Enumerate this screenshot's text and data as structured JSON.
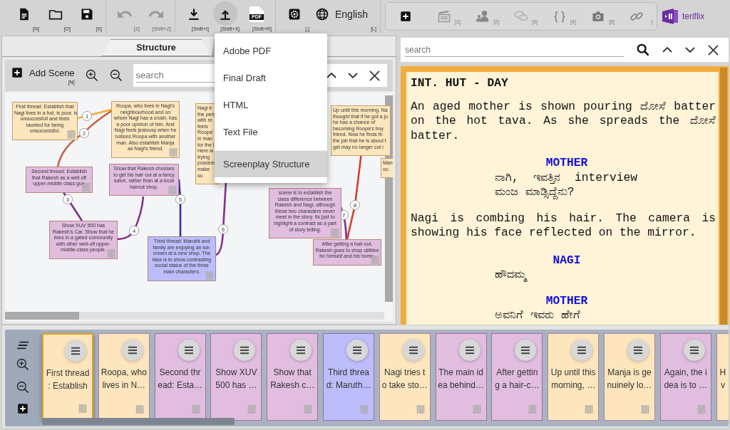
{
  "toolbar": {
    "groups": [
      [
        {
          "kind": "new",
          "shortcut": "[N]",
          "disabled": false,
          "active": false
        },
        {
          "kind": "open",
          "shortcut": "[O]",
          "disabled": false,
          "active": false
        },
        {
          "kind": "save",
          "shortcut": "[S]",
          "disabled": false,
          "active": false
        }
      ],
      [
        {
          "kind": "undo",
          "shortcut": "[Z]",
          "disabled": true,
          "active": false
        },
        {
          "kind": "redo",
          "shortcut": "[Shift+Z]",
          "disabled": true,
          "active": false
        }
      ],
      [
        {
          "kind": "import",
          "shortcut": "[Shift+I]",
          "disabled": false,
          "active": false
        },
        {
          "kind": "export",
          "shortcut": "[Shift+X]",
          "disabled": false,
          "active": true
        },
        {
          "kind": "pdf",
          "icon_text": "PDF",
          "shortcut": "[Shift+R]",
          "disabled": false,
          "active": false
        }
      ],
      [
        {
          "kind": "settings",
          "shortcut": "[,]",
          "disabled": false,
          "active": false
        },
        {
          "kind": "language",
          "label": "English",
          "shortcut": "[L]",
          "disabled": false,
          "active": false
        }
      ]
    ]
  },
  "insert_toolbar": [
    {
      "kind": "add"
    },
    {
      "kind": "scene",
      "shortcut": "[1]"
    },
    {
      "kind": "character",
      "shortcut": "[2]"
    },
    {
      "kind": "dialogue",
      "shortcut": "[3]"
    },
    {
      "kind": "braces",
      "icon_text": "{ }",
      "shortcut": "[4]"
    },
    {
      "kind": "camera",
      "shortcut": "[5]"
    },
    {
      "kind": "link",
      "shortcut": "["
    }
  ],
  "logo": {
    "text": "teriflix"
  },
  "export_menu": [
    {
      "label": "Adobe PDF",
      "selected": false
    },
    {
      "label": "Final Draft",
      "selected": false
    },
    {
      "label": "HTML",
      "selected": false
    },
    {
      "label": "Text File",
      "selected": false
    },
    {
      "label": "Screenplay Structure",
      "selected": true
    }
  ],
  "structure": {
    "tabs": [
      {
        "label": "Structure",
        "selected": true
      },
      {
        "selected": false
      }
    ],
    "add_scene": {
      "label": "Add Scene",
      "shortcut": "[N]"
    },
    "search": {
      "placeholder": "search"
    },
    "notes": [
      {
        "color": "#fde6bd",
        "lines": [
          "First thread: Establish that",
          "Nagi lives in a hut, is poor, is",
          "unsuccesfull and feels",
          "taunted for being",
          "unsuccessful."
        ]
      },
      {
        "color": "#fde6bd",
        "lines": [
          "Roopa, who lives in Nagi's",
          "neighbourhood and on",
          "whom Nagi has a crush, has",
          "a poor opinion of him. And",
          "Nagi feels jealousy when he",
          "notices Roopa with another",
          "man. Also establish Manja",
          "as Nagi's friend."
        ]
      },
      {
        "color": "#fde6bd",
        "lines": [
          "Nagi tr",
          "the pers",
          "with re",
          "feels",
          "Roopa'",
          "in man",
          "for the l",
          "Here w",
          "trying",
          "possess",
          "make",
          "su"
        ]
      },
      {
        "color": "#fde6bd",
        "lines": [
          "Up until this morning, Na",
          "thought that if he got a jo",
          "he has a chance of",
          "becoming Roopa's boy",
          "friend. Now he finds th",
          "the job that he is about t",
          "get may no longer cut i"
        ]
      },
      {
        "color": "#e1bde0",
        "lines": [
          "Second thread: Establish",
          "that Rakesh as a well off",
          "upper-middle class guy."
        ]
      },
      {
        "color": "#e1bde0",
        "lines": [
          "Show that Rakesh chooses",
          "to get his hair cut at a fancy",
          "salon, rather than at a local",
          "haircut shop."
        ]
      },
      {
        "color": "#fde6bd",
        "lines": [
          "Man",
          "ou"
        ]
      },
      {
        "color": "#e1bde0",
        "lines": [
          "scene is to establish the",
          "class difference between",
          "Rakesh and Nagi, although",
          "these two characters never",
          "meet in the story. Its just to",
          "highlight a contrast as a part",
          "of story telling."
        ]
      },
      {
        "color": "#e1bde0",
        "lines": [
          "Show XUV 500 has",
          "Rakesh's Car. Show that he",
          "lives in a gated community",
          "with other well-off upper-",
          "middle-class people."
        ]
      },
      {
        "color": "#bdbdfb",
        "lines": [
          "Third thread: Maruthi and",
          "family are enjoying an ice-",
          "cream at a new shop. The",
          "idea is to show contrasting",
          "social status of the three",
          "main characters."
        ]
      },
      {
        "color": "#e1bde0",
        "lines": [
          "After getting a hair-cut,",
          "Rakesh goes to shop utilities",
          "for himself and his home."
        ]
      }
    ],
    "links": [
      {
        "label": "1",
        "color": "#f0b030"
      },
      {
        "label": "2",
        "color": "#c06040"
      },
      {
        "label": "3",
        "color": "#80308a"
      },
      {
        "label": "4",
        "color": "#80308a"
      },
      {
        "label": "5",
        "color": "#3030b0"
      },
      {
        "label": "6",
        "color": "#80308a"
      },
      {
        "label": "7",
        "color": "#80308a"
      },
      {
        "label": "8",
        "color": "#d04030"
      }
    ]
  },
  "screenplay": {
    "search": {
      "placeholder": "search"
    },
    "elements": [
      {
        "kind": "heading",
        "text": "INT. HUT - DAY"
      },
      {
        "kind": "action",
        "text": "An aged mother is shown pouring ದೋಸೆ batter on the hot tava. As she spreads the ದೋಸೆ batter."
      },
      {
        "kind": "character",
        "text": "MOTHER"
      },
      {
        "kind": "dialogue",
        "text": "ನಾಗಿ, ಇವತ್ತಿನ interview ಮಂಜ ಮಾಡ್ಸಿದ್ದೆನು?"
      },
      {
        "kind": "action",
        "text": "Nagi is combing his hair. The camera is showing his face reflected on the mirror."
      },
      {
        "kind": "character",
        "text": "NAGI"
      },
      {
        "kind": "dialogue",
        "text": "ಹೌದಮ್ಮ"
      },
      {
        "kind": "character",
        "text": "MOTHER"
      },
      {
        "kind": "dialogue",
        "text": "ಅವನಿಗೆ ಇವರು ಹೇಗೆ"
      }
    ]
  },
  "timeline": {
    "cards": [
      {
        "color": "#fde6bd",
        "selected": true,
        "lines": [
          "First thread",
          ": Establish"
        ]
      },
      {
        "color": "#fde6bd",
        "selected": false,
        "lines": [
          "Roopa, who",
          "lives in N…"
        ]
      },
      {
        "color": "#e1bde0",
        "selected": false,
        "lines": [
          "Second thr",
          "ead: Esta…"
        ]
      },
      {
        "color": "#e1bde0",
        "selected": false,
        "lines": [
          "Show XUV",
          "500 has …"
        ]
      },
      {
        "color": "#e1bde0",
        "selected": false,
        "lines": [
          "Show that",
          "Rakesh c…"
        ]
      },
      {
        "color": "#bdbdfb",
        "selected": false,
        "lines": [
          "Third threa",
          "d: Maruth…"
        ]
      },
      {
        "color": "#fde6bd",
        "selected": false,
        "lines": [
          "Nagi tries t",
          "o take sto…"
        ]
      },
      {
        "color": "#e1bde0",
        "selected": false,
        "lines": [
          "The main id",
          "ea behind…"
        ]
      },
      {
        "color": "#e1bde0",
        "selected": false,
        "lines": [
          "After gettin",
          "g a hair-c…"
        ]
      },
      {
        "color": "#fde6bd",
        "selected": false,
        "lines": [
          "Up until this",
          "morning, …"
        ]
      },
      {
        "color": "#fde6bd",
        "selected": false,
        "lines": [
          "Manja is ge",
          "nuinely lo…"
        ]
      },
      {
        "color": "#e1bde0",
        "selected": false,
        "lines": [
          "Again, the i",
          "dea is to …"
        ]
      },
      {
        "color": "#fde6bd",
        "selected": false,
        "lines": [
          "H",
          "v"
        ]
      }
    ]
  }
}
